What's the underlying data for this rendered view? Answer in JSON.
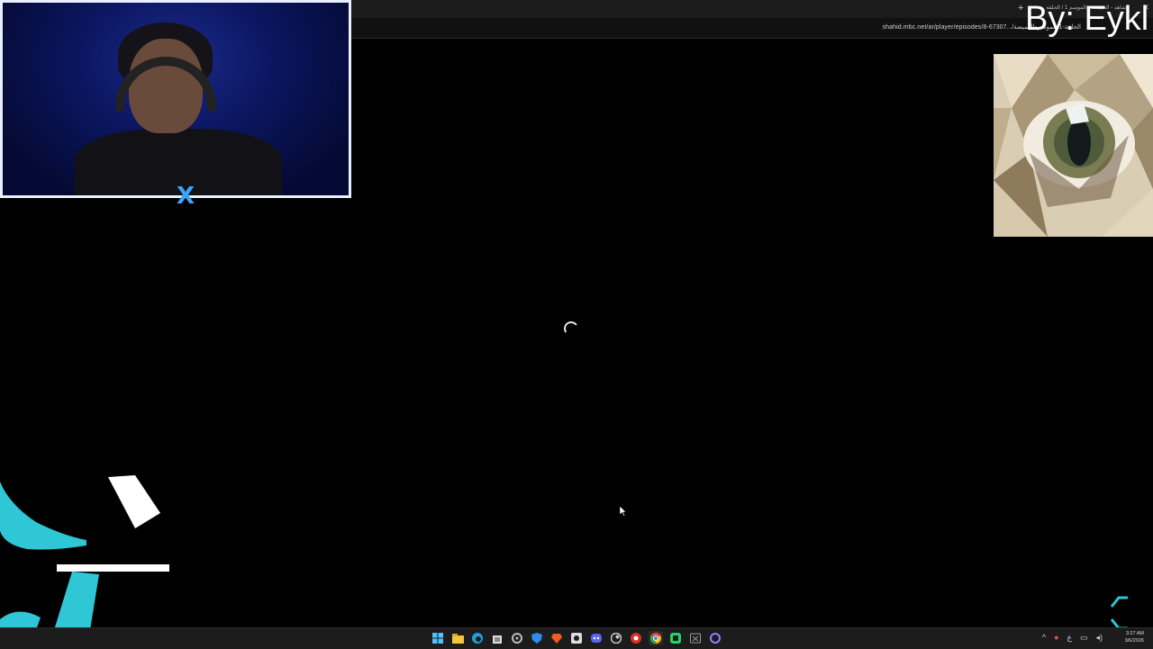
{
  "browser": {
    "url": "shahid.mbc.net/ar/player/episodes/8-الحلقة-1-الموسم-العميضة/...67307",
    "tab_title": "شاهد - العميضة - الموسم 1 / الحلقة",
    "new_tab_symbol": "+",
    "close_symbol": "✕"
  },
  "overlay": {
    "byline": "By: Eykl"
  },
  "webcam": {
    "logo_text": "X"
  },
  "player": {
    "state": "loading"
  },
  "taskbar": {
    "icons": [
      "windows-start-icon",
      "file-explorer-icon",
      "edge-icon",
      "store-icon",
      "settings-icon",
      "defender-icon",
      "brave-icon",
      "capture-icon",
      "discord-icon",
      "steam-icon",
      "chrome-red-icon",
      "chrome-icon",
      "whatsapp-icon",
      "xbox-icon",
      "app-circle-icon"
    ],
    "tray_up_arrow": "^",
    "keyboard_lang": "ع",
    "time": "3:27 AM",
    "date": "3/6/2026"
  },
  "colors": {
    "accent_cyan": "#2fc6d6",
    "cam_border": "#e9f0ff",
    "logo_blue": "#3aa5ff"
  }
}
